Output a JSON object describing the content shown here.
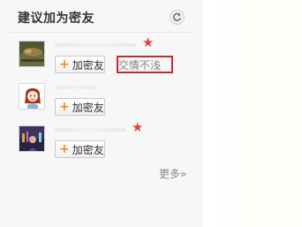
{
  "panel": {
    "title": "建议加为密友",
    "refresh_icon": "refresh-icon"
  },
  "suggestions": [
    {
      "add_label": "加密友",
      "has_star": true,
      "reason": "交情不浅",
      "avatar": "photo-avatar"
    },
    {
      "add_label": "加密友",
      "has_star": false,
      "reason": "",
      "avatar": "cartoon-avatar"
    },
    {
      "add_label": "加密友",
      "has_star": true,
      "reason": "",
      "avatar": "night-photo-avatar"
    }
  ],
  "footer": {
    "more_label": "更多»"
  },
  "colors": {
    "accent_plus": "#f08a1c",
    "star": "#d9463a",
    "highlight_box": "#c82a2a"
  }
}
